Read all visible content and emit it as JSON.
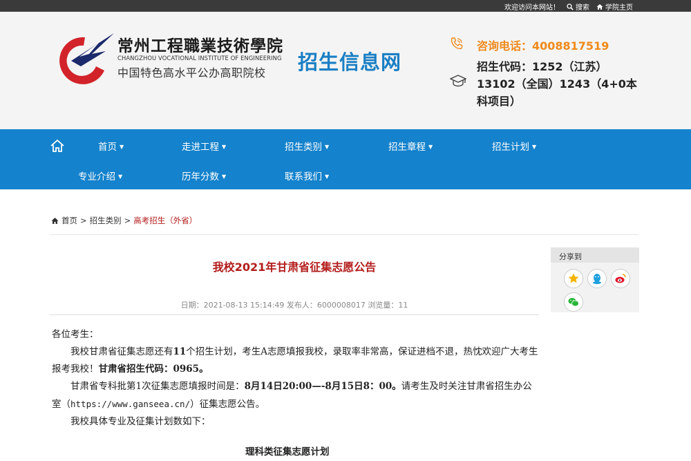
{
  "topbar": {
    "welcome": "欢迎访问本网站！",
    "search": "搜索",
    "school_home": "学院主页"
  },
  "header": {
    "school_name_cn": "常州工程職業技術學院",
    "school_name_en": "CHANGZHOU VOCATIONAL INSTITUTE OF ENGINEERING",
    "school_tagline": "中国特色高水平公办高职院校",
    "site_title": "招生信息网",
    "phone_label": "咨询电话：4008817519",
    "enroll_code": "招生代码：1252（江苏）13102（全国）1243（4+0本科项目）",
    "colors": {
      "brand_blue": "#1a7fc5",
      "accent_orange": "#f08a1c",
      "logo_red": "#d2232a",
      "logo_navy": "#1b2a6b"
    }
  },
  "nav": {
    "items": [
      {
        "label": "首页"
      },
      {
        "label": "走进工程"
      },
      {
        "label": "招生类别"
      },
      {
        "label": "招生章程"
      },
      {
        "label": "招生计划"
      },
      {
        "label": "专业介绍"
      },
      {
        "label": "历年分数"
      },
      {
        "label": "联系我们"
      }
    ],
    "caret": "▼",
    "background": "#1482cc"
  },
  "breadcrumb": {
    "home": "首页",
    "sep": ">",
    "level1": "招生类别",
    "current": "高考招生（外省）"
  },
  "article": {
    "title": "我校2021年甘肃省征集志愿公告",
    "meta": "日期：2021-08-13 15:14:49  发布人：6000008017  浏览量：11",
    "greeting": "各位考生：",
    "para1_a": "我校甘肃省征集志愿还有",
    "para1_num": "11",
    "para1_b": "个招生计划，考生A志愿填报我校，录取率非常高，保证进档不退，热忱欢迎广大考生报考我校！",
    "para1_code": "甘肃省招生代码：0965。",
    "para2_a": "甘肃省专科批第1次征集志愿填报时间是：",
    "para2_time": "8月14日20:00—-8月15日8：00。",
    "para2_b": "请考生及时关注甘肃省招生办公室（",
    "para2_url": "https://www.ganseea.cn/",
    "para2_c": "）征集志愿公告。",
    "para3": "我校具体专业及征集计划数如下：",
    "table_title": "理科类征集志愿计划"
  },
  "share": {
    "label": "分享到",
    "buttons": [
      {
        "name": "qzone",
        "icon": "star-icon",
        "color": "#f5b400"
      },
      {
        "name": "qq",
        "icon": "qq-icon",
        "color": "#1ea0e0"
      },
      {
        "name": "weibo",
        "icon": "weibo-icon",
        "color": "#e6162d"
      },
      {
        "name": "wechat",
        "icon": "wechat-icon",
        "color": "#2bb63a"
      }
    ]
  }
}
